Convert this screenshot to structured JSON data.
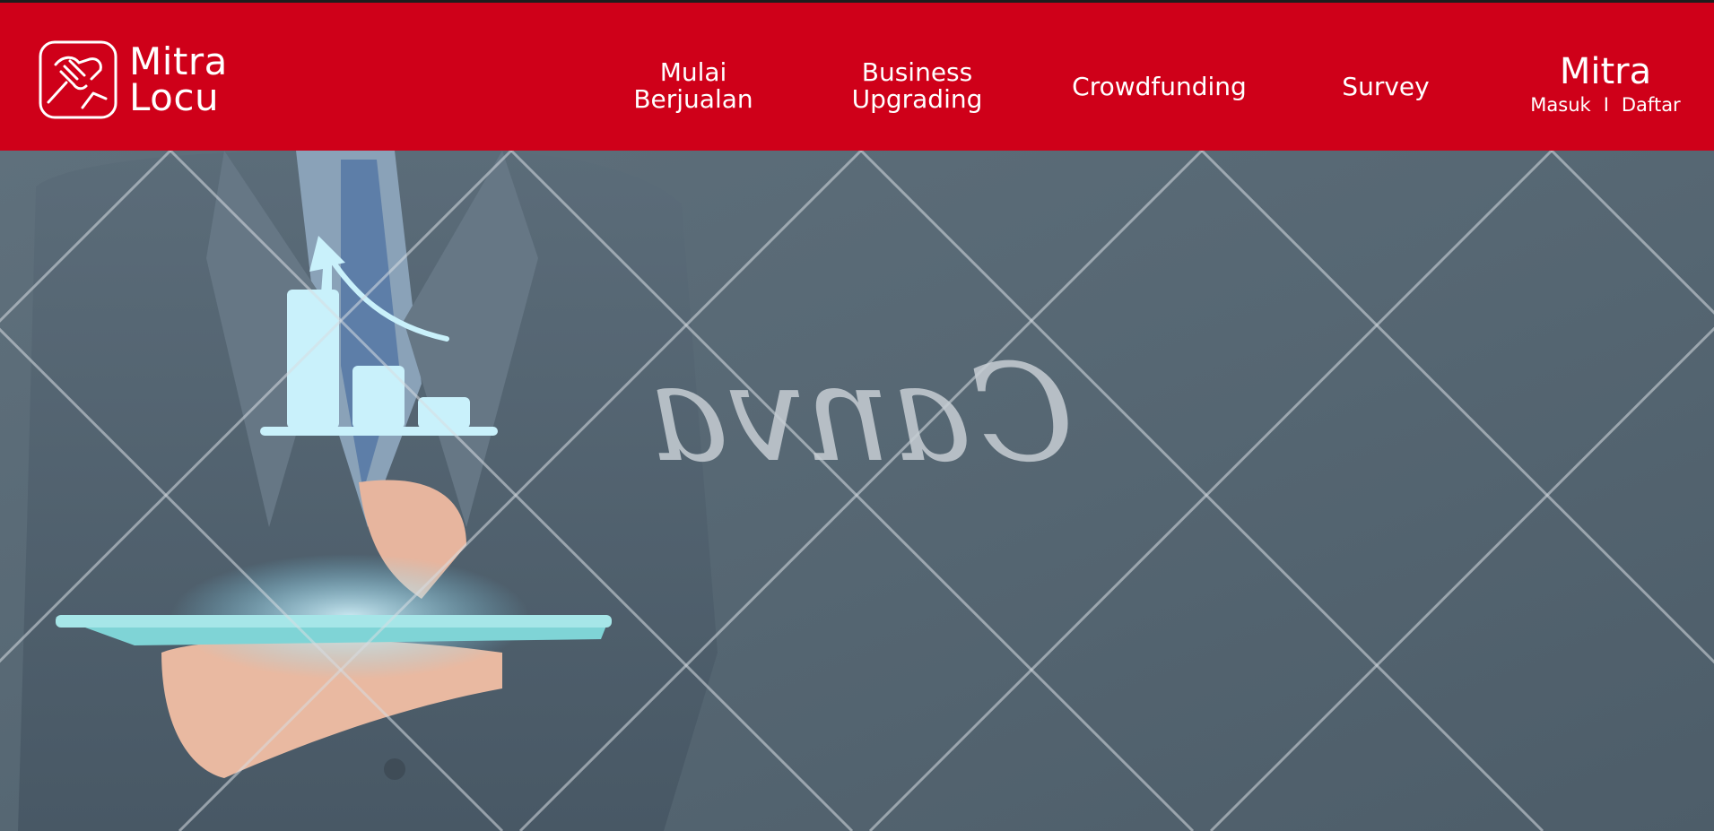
{
  "header": {
    "logo": {
      "line1": "Mitra",
      "line2": "Locu"
    },
    "nav": [
      {
        "line1": "Mulai",
        "line2": "Berjualan"
      },
      {
        "line1": "Business",
        "line2": "Upgrading"
      },
      {
        "line1": "Crowdfunding"
      },
      {
        "line1": "Survey"
      }
    ],
    "account": {
      "title": "Mitra",
      "login": "Masuk",
      "separator": "I",
      "register": "Daftar"
    }
  },
  "hero": {
    "watermark": "Canva"
  },
  "colors": {
    "brand_red": "#cf0019",
    "hero_bg": "#4f606d",
    "text_on_brand": "#ffffff"
  },
  "icons": [
    "handshake-logo-icon"
  ]
}
